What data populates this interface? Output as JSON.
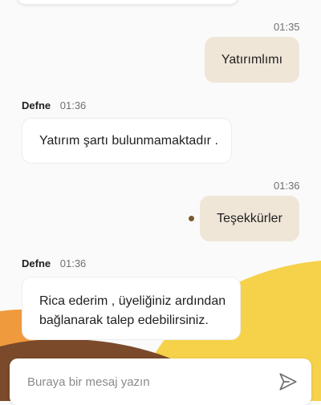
{
  "colors": {
    "background": "#fafafa",
    "outgoing_bubble": "#efe6d8",
    "incoming_bubble": "#ffffff",
    "accent_yellow": "#f6d24a",
    "accent_orange": "#ef9a3c",
    "accent_brown": "#7a4a2a"
  },
  "messages": [
    {
      "direction": "outgoing",
      "time": "01:35",
      "text": "Yatırımlımı"
    },
    {
      "direction": "incoming",
      "sender": "Defne",
      "time": "01:36",
      "text": "Yatırım şartı bulunmamaktadır ."
    },
    {
      "direction": "outgoing",
      "time": "01:36",
      "text": "Teşekkürler"
    },
    {
      "direction": "incoming",
      "sender": "Defne",
      "time": "01:36",
      "text_line1": "Rica ederim , üyeliğiniz ardından",
      "text_line2": "bağlanarak talep edebilirsiniz."
    }
  ],
  "composer": {
    "placeholder": "Buraya bir mesaj yazın",
    "send_icon": "send-icon"
  }
}
